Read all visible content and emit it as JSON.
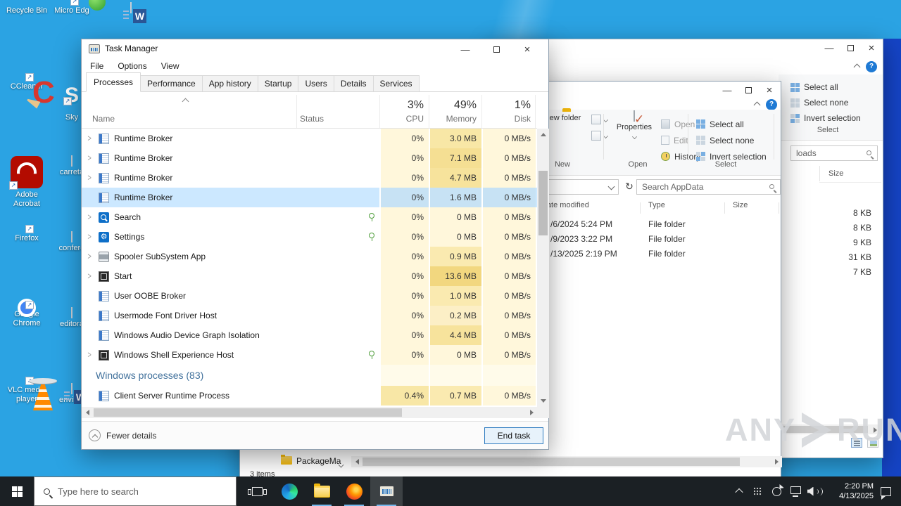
{
  "colors": {
    "wallpaper": "#2BA3E3",
    "right_band": "#1544C6",
    "taskbar": "#1B2024",
    "selected_row": "#CCE8FF",
    "accent": "#0078D7",
    "group_header_text": "#41719C"
  },
  "desktop": {
    "icons_col1": [
      {
        "label": "Recycle Bin",
        "icon": "recycle-bin",
        "badge": false
      },
      {
        "label": "CCleaner",
        "icon": "ccleaner",
        "badge": true
      },
      {
        "label": "Adobe Acrobat",
        "icon": "acrobat",
        "badge": true
      },
      {
        "label": "Firefox",
        "icon": "firefox",
        "badge": true
      },
      {
        "label": "Google Chrome",
        "icon": "chrome",
        "badge": true
      },
      {
        "label": "VLC media player",
        "icon": "vlc",
        "badge": true
      }
    ],
    "icons_col2": [
      {
        "label": "Micro Edg",
        "icon": "edge",
        "badge": true
      },
      {
        "label": "Sky",
        "icon": "skype",
        "badge": true
      },
      {
        "label": "carreta",
        "icon": "image-file",
        "badge": false
      },
      {
        "label": "confere",
        "icon": "image-file",
        "badge": false
      },
      {
        "label": "editora",
        "icon": "image-file",
        "badge": false
      },
      {
        "label": "environ",
        "icon": "word-file",
        "badge": false
      }
    ]
  },
  "taskmanager": {
    "title": "Task Manager",
    "menu": [
      "File",
      "Options",
      "View"
    ],
    "tabs": [
      "Processes",
      "Performance",
      "App history",
      "Startup",
      "Users",
      "Details",
      "Services"
    ],
    "selected_tab": "Processes",
    "columns": {
      "name": "Name",
      "status": "Status",
      "cpu": "CPU",
      "memory": "Memory",
      "disk": "Disk"
    },
    "totals": {
      "cpu": "3%",
      "memory": "49%",
      "disk": "1%"
    },
    "rows": [
      {
        "name": "Runtime Broker",
        "icon": "window",
        "chevron": true,
        "leaf": false,
        "selected": false,
        "cpu": "0%",
        "memory": "3.0 MB",
        "disk": "0 MB/s",
        "cpu_bg": "#FFF7DB",
        "mem_bg": "#F8E7A6",
        "disk_bg": "#FFF7DB"
      },
      {
        "name": "Runtime Broker",
        "icon": "window",
        "chevron": true,
        "leaf": false,
        "selected": false,
        "cpu": "0%",
        "memory": "7.1 MB",
        "disk": "0 MB/s",
        "cpu_bg": "#FFF7DB",
        "mem_bg": "#F5DF93",
        "disk_bg": "#FFF7DB"
      },
      {
        "name": "Runtime Broker",
        "icon": "window",
        "chevron": true,
        "leaf": false,
        "selected": false,
        "cpu": "0%",
        "memory": "4.7 MB",
        "disk": "0 MB/s",
        "cpu_bg": "#FFF7DB",
        "mem_bg": "#F7E39C",
        "disk_bg": "#FFF7DB"
      },
      {
        "name": "Runtime Broker",
        "icon": "window",
        "chevron": false,
        "leaf": false,
        "selected": true,
        "cpu": "0%",
        "memory": "1.6 MB",
        "disk": "0 MB/s",
        "cpu_bg": "#C7E2F4",
        "mem_bg": "#C7E2F4",
        "disk_bg": "#C7E2F4"
      },
      {
        "name": "Search",
        "icon": "search",
        "chevron": true,
        "leaf": true,
        "selected": false,
        "cpu": "0%",
        "memory": "0 MB",
        "disk": "0 MB/s",
        "cpu_bg": "#FFF7DB",
        "mem_bg": "#FFF7DB",
        "disk_bg": "#FFF7DB"
      },
      {
        "name": "Settings",
        "icon": "gear",
        "chevron": true,
        "leaf": true,
        "selected": false,
        "cpu": "0%",
        "memory": "0 MB",
        "disk": "0 MB/s",
        "cpu_bg": "#FFF7DB",
        "mem_bg": "#FFF7DB",
        "disk_bg": "#FFF7DB"
      },
      {
        "name": "Spooler SubSystem App",
        "icon": "printer",
        "chevron": true,
        "leaf": false,
        "selected": false,
        "cpu": "0%",
        "memory": "0.9 MB",
        "disk": "0 MB/s",
        "cpu_bg": "#FFF7DB",
        "mem_bg": "#FAEAB0",
        "disk_bg": "#FFF7DB"
      },
      {
        "name": "Start",
        "icon": "window-dark",
        "chevron": true,
        "leaf": false,
        "selected": false,
        "cpu": "0%",
        "memory": "13.6 MB",
        "disk": "0 MB/s",
        "cpu_bg": "#FFF7DB",
        "mem_bg": "#F2D77F",
        "disk_bg": "#FFF7DB"
      },
      {
        "name": "User OOBE Broker",
        "icon": "window",
        "chevron": false,
        "leaf": false,
        "selected": false,
        "cpu": "0%",
        "memory": "1.0 MB",
        "disk": "0 MB/s",
        "cpu_bg": "#FFF7DB",
        "mem_bg": "#FAEAB0",
        "disk_bg": "#FFF7DB"
      },
      {
        "name": "Usermode Font Driver Host",
        "icon": "window",
        "chevron": false,
        "leaf": false,
        "selected": false,
        "cpu": "0%",
        "memory": "0.2 MB",
        "disk": "0 MB/s",
        "cpu_bg": "#FFF7DB",
        "mem_bg": "#FCEFC6",
        "disk_bg": "#FFF7DB"
      },
      {
        "name": "Windows Audio Device Graph Isolation",
        "icon": "window",
        "chevron": false,
        "leaf": false,
        "selected": false,
        "cpu": "0%",
        "memory": "4.4 MB",
        "disk": "0 MB/s",
        "cpu_bg": "#FFF7DB",
        "mem_bg": "#F7E39C",
        "disk_bg": "#FFF7DB"
      },
      {
        "name": "Windows Shell Experience Host",
        "icon": "window-dark",
        "chevron": true,
        "leaf": true,
        "selected": false,
        "cpu": "0%",
        "memory": "0 MB",
        "disk": "0 MB/s",
        "cpu_bg": "#FFF7DB",
        "mem_bg": "#FFF7DB",
        "disk_bg": "#FFF7DB"
      },
      {
        "group": true,
        "name": "Windows processes (83)"
      },
      {
        "name": "Client Server Runtime Process",
        "icon": "window",
        "chevron": false,
        "leaf": false,
        "selected": false,
        "cpu": "0.4%",
        "memory": "0.7 MB",
        "disk": "0 MB/s",
        "cpu_bg": "#F8E7A6",
        "mem_bg": "#FAEAB0",
        "disk_bg": "#FFF7DB"
      }
    ],
    "footer": {
      "fewer_details": "Fewer details",
      "end_task": "End task"
    }
  },
  "explorer_front": {
    "ribbon": {
      "new_folder": "New folder",
      "properties": "Properties",
      "open": "Open",
      "edit": "Edit",
      "history": "History",
      "select_all": "Select all",
      "select_none": "Select none",
      "invert_selection": "Invert selection",
      "group_new": "New",
      "group_open": "Open",
      "group_select": "Select"
    },
    "search_placeholder": "Search AppData",
    "columns": {
      "date": "Date modified",
      "type": "Type",
      "size": "Size"
    },
    "files": [
      {
        "date": "/6/2024 5:24 PM",
        "type": "File folder"
      },
      {
        "date": "/9/2023 3:22 PM",
        "type": "File folder"
      },
      {
        "date": "/13/2025 2:19 PM",
        "type": "File folder"
      }
    ],
    "breadcrumb": "PackageMa",
    "status": "3 items"
  },
  "explorer_back": {
    "ribbon": {
      "select_all": "Select all",
      "select_none": "Select none",
      "invert_selection": "Invert selection",
      "group_select": "Select"
    },
    "search_value": "loads",
    "size_column": "Size",
    "sizes": [
      "8 KB",
      "8 KB",
      "9 KB",
      "31 KB",
      "7 KB"
    ]
  },
  "taskbar": {
    "search_placeholder": "Type here to search",
    "clock_time": "2:20 PM",
    "clock_date": "4/13/2025"
  },
  "watermark": {
    "left": "ANY",
    "right": "RUN"
  }
}
